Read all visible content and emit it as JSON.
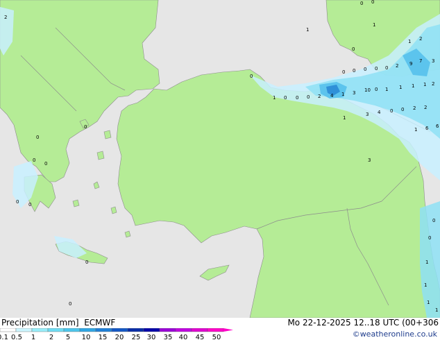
{
  "header": {
    "product": "Precipitation [mm]",
    "model": "ECMWF",
    "valid_time": "Mo 22-12-2025 12..18 UTC (00+306"
  },
  "credit": "©weatheronline.co.uk",
  "legend": {
    "labels": [
      "0.1",
      "0.5",
      "1",
      "2",
      "5",
      "10",
      "15",
      "20",
      "25",
      "30",
      "35",
      "40",
      "45",
      "50"
    ],
    "colors": [
      "#ffffff",
      "#ccf6ff",
      "#99eefa",
      "#6fdcf3",
      "#4ec6ec",
      "#30a7e4",
      "#2080d8",
      "#1458c6",
      "#0a2ea8",
      "#0000aa",
      "#9a00d8",
      "#c000e0",
      "#e000d0",
      "#ff00c8"
    ]
  },
  "map": {
    "colors": {
      "sea": "#e6e6e6",
      "land": "#b5ec96",
      "border": "#8c8c8c",
      "light_precip": "#c8f0ff",
      "moderate_precip": "#8ee0f5",
      "heavy_precip": "#55c0ec",
      "heaviest_precip": "#2f90d8"
    },
    "values": [
      {
        "t": "0"
      },
      {
        "t": "0"
      },
      {
        "t": "1"
      },
      {
        "t": "1"
      },
      {
        "t": "2"
      },
      {
        "t": "1"
      },
      {
        "t": "0"
      },
      {
        "t": "9"
      },
      {
        "t": "7"
      },
      {
        "t": "3"
      },
      {
        "t": "0"
      },
      {
        "t": "0"
      },
      {
        "t": "0"
      },
      {
        "t": "0"
      },
      {
        "t": "0"
      },
      {
        "t": "2"
      },
      {
        "t": "0"
      },
      {
        "t": "1"
      },
      {
        "t": "0"
      },
      {
        "t": "0"
      },
      {
        "t": "0"
      },
      {
        "t": "2"
      },
      {
        "t": "4"
      },
      {
        "t": "1"
      },
      {
        "t": "3"
      },
      {
        "t": "10"
      },
      {
        "t": "0"
      },
      {
        "t": "1"
      },
      {
        "t": "1"
      },
      {
        "t": "1"
      },
      {
        "t": "1"
      },
      {
        "t": "2"
      },
      {
        "t": "3"
      },
      {
        "t": "4"
      },
      {
        "t": "0"
      },
      {
        "t": "0"
      },
      {
        "t": "2"
      },
      {
        "t": "2"
      },
      {
        "t": "1"
      },
      {
        "t": "6"
      },
      {
        "t": "6"
      },
      {
        "t": "1"
      },
      {
        "t": "3"
      },
      {
        "t": "2"
      },
      {
        "t": "0"
      },
      {
        "t": "0"
      },
      {
        "t": "0"
      },
      {
        "t": "0"
      },
      {
        "t": "0"
      },
      {
        "t": "0"
      },
      {
        "t": "0"
      },
      {
        "t": "0"
      },
      {
        "t": "0"
      },
      {
        "t": "0"
      },
      {
        "t": "1"
      },
      {
        "t": "1"
      },
      {
        "t": "1"
      },
      {
        "t": "1"
      }
    ]
  }
}
